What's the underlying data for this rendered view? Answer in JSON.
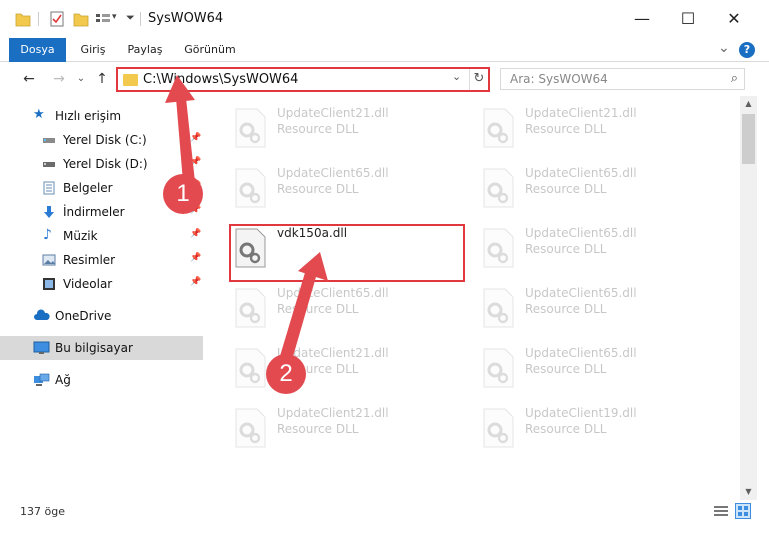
{
  "titlebar": {
    "title": "SysWOW64",
    "minimize": "—",
    "maximize": "☐",
    "close": "✕"
  },
  "ribbon": {
    "tabs": [
      {
        "label": "Dosya",
        "active": true
      },
      {
        "label": "Giriş",
        "active": false
      },
      {
        "label": "Paylaş",
        "active": false
      },
      {
        "label": "Görünüm",
        "active": false
      }
    ],
    "expand": "⌄",
    "help": "?"
  },
  "nav": {
    "back": "←",
    "forward": "→",
    "dropdown": "⌄",
    "up": "↑",
    "address": "C:\\Windows\\SysWOW64",
    "address_dropdown": "⌄",
    "refresh": "↻",
    "search_placeholder": "Ara: SysWOW64",
    "search_icon": "⌕"
  },
  "sidebar": {
    "items": [
      {
        "label": "Hızlı erişim",
        "icon": "star-icon",
        "pinned": false
      },
      {
        "label": "Yerel Disk (C:)",
        "icon": "drive-icon",
        "pinned": true
      },
      {
        "label": "Yerel Disk (D:)",
        "icon": "drive-icon",
        "pinned": true
      },
      {
        "label": "Belgeler",
        "icon": "documents-icon",
        "pinned": true
      },
      {
        "label": "İndirmeler",
        "icon": "download-icon",
        "pinned": true
      },
      {
        "label": "Müzik",
        "icon": "music-icon",
        "pinned": true
      },
      {
        "label": "Resimler",
        "icon": "pictures-icon",
        "pinned": true
      },
      {
        "label": "Videolar",
        "icon": "videos-icon",
        "pinned": true
      },
      {
        "label": "OneDrive",
        "icon": "cloud-icon",
        "pinned": false
      },
      {
        "label": "Bu bilgisayar",
        "icon": "computer-icon",
        "pinned": false,
        "selected": true
      },
      {
        "label": "Ağ",
        "icon": "network-icon",
        "pinned": false
      }
    ],
    "pin_glyph": "📌"
  },
  "files": [
    {
      "name": "UpdateClient21.dll",
      "type": "Resource DLL",
      "faded": true
    },
    {
      "name": "UpdateClient21.dll",
      "type": "Resource DLL",
      "faded": true
    },
    {
      "name": "UpdateClient65.dll",
      "type": "Resource DLL",
      "faded": true
    },
    {
      "name": "UpdateClient65.dll",
      "type": "Resource DLL",
      "faded": true
    },
    {
      "name": "vdk150a.dll",
      "type": "",
      "faded": false
    },
    {
      "name": "UpdateClient65.dll",
      "type": "Resource DLL",
      "faded": true
    },
    {
      "name": "UpdateClient65.dll",
      "type": "Resource DLL",
      "faded": true
    },
    {
      "name": "UpdateClient65.dll",
      "type": "Resource DLL",
      "faded": true
    },
    {
      "name": "UpdateClient21.dll",
      "type": "Resource DLL",
      "faded": true
    },
    {
      "name": "UpdateClient65.dll",
      "type": "Resource DLL",
      "faded": true
    },
    {
      "name": "UpdateClient21.dll",
      "type": "Resource DLL",
      "faded": true
    },
    {
      "name": "UpdateClient19.dll",
      "type": "Resource DLL",
      "faded": true
    }
  ],
  "status": {
    "count": "137 öge"
  },
  "annotations": {
    "badge1": "1",
    "badge2": "2",
    "color": "#e24a50"
  },
  "colors": {
    "accent": "#1a6fc2",
    "highlight_border": "#e0383e"
  }
}
